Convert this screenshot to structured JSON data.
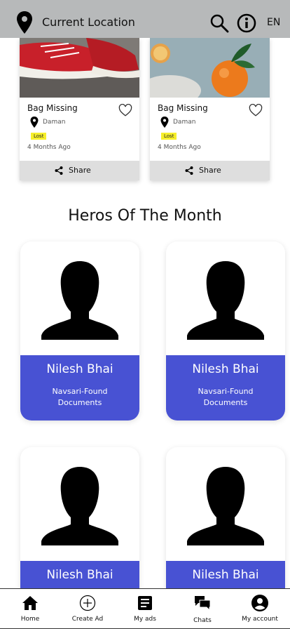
{
  "header": {
    "location_label": "Current Location",
    "language": "EN",
    "icons": [
      "location-pin-icon",
      "search-icon",
      "info-icon"
    ]
  },
  "ads": [
    {
      "title": "Bag Missing",
      "place": "Daman",
      "badge": "Lost",
      "time": "4 Months Ago",
      "share_label": "Share",
      "image": "red-sneakers"
    },
    {
      "title": "Bag Missing",
      "place": "Daman",
      "badge": "Lost",
      "time": "4 Months Ago",
      "share_label": "Share",
      "image": "orange-fruit"
    }
  ],
  "section": {
    "title": "Heros Of The Month"
  },
  "heroes": [
    {
      "name": "Nilesh Bhai",
      "desc": "Navsari-Found Documents"
    },
    {
      "name": "Nilesh Bhai",
      "desc": "Navsari-Found Documents"
    },
    {
      "name": "Nilesh Bhai",
      "desc": ""
    },
    {
      "name": "Nilesh Bhai",
      "desc": ""
    }
  ],
  "nav": [
    {
      "label": "Home",
      "icon": "home-icon"
    },
    {
      "label": "Create Ad",
      "icon": "plus-circle-icon"
    },
    {
      "label": "My ads",
      "icon": "document-icon"
    },
    {
      "label": "Chats",
      "icon": "chat-icon"
    },
    {
      "label": "My account",
      "icon": "account-icon"
    }
  ],
  "colors": {
    "topbar": "#b7b9ba",
    "hero_band": "#4852d3",
    "badge": "#f6ef2a",
    "share_bar": "#dedede"
  }
}
